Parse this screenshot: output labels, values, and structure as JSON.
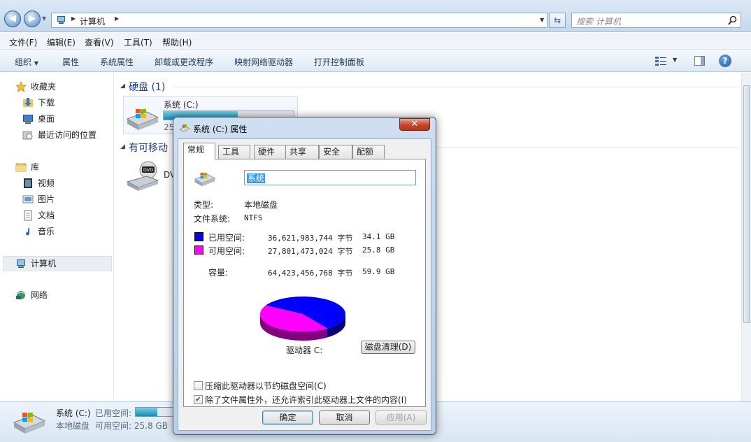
{
  "address_bar": {
    "breadcrumb": "计算机",
    "search_placeholder": "搜索 计算机"
  },
  "menu": [
    "文件(F)",
    "编辑(E)",
    "查看(V)",
    "工具(T)",
    "帮助(H)"
  ],
  "commands": [
    "组织",
    "属性",
    "系统属性",
    "卸载或更改程序",
    "映射网络驱动器",
    "打开控制面板"
  ],
  "sidebar": {
    "favorites": "收藏夹",
    "favorites_items": [
      "下载",
      "桌面",
      "最近访问的位置"
    ],
    "libraries": "库",
    "libraries_items": [
      "视频",
      "图片",
      "文档",
      "音乐"
    ],
    "computer": "计算机",
    "network": "网络"
  },
  "main": {
    "group_hdd": "硬盘 (1)",
    "group_removable": "有可移动",
    "drive_name": "系统 (C:)",
    "drive_free_cut": "25",
    "drive_used_fraction": 0.57,
    "dvd_label_cut": "DV"
  },
  "details": {
    "name": "系统 (C:)",
    "used_label": "已用空间:",
    "type": "本地磁盘",
    "free_text": "可用空间: 25.8 GB",
    "used_fraction": 0.57
  },
  "dialog": {
    "title": "系统 (C:) 属性",
    "close": "✕",
    "tabs": [
      "常规",
      "工具",
      "硬件",
      "共享",
      "安全",
      "配额"
    ],
    "label_value": "系统",
    "type_label": "类型:",
    "type_value": "本地磁盘",
    "fs_label": "文件系统:",
    "fs_value": "NTFS",
    "used_label": "已用空间:",
    "used_bytes": "36,621,983,744 字节",
    "used_gb": "34.1 GB",
    "free_label": "可用空间:",
    "free_bytes": "27,801,473,024 字节",
    "free_gb": "25.8 GB",
    "capacity_label": "容量:",
    "capacity_bytes": "64,423,456,768 字节",
    "capacity_gb": "59.9 GB",
    "drive_caption": "驱动器 C:",
    "cleanup": "磁盘清理(D)",
    "compress": "压缩此驱动器以节约磁盘空间(C)",
    "index": "除了文件属性外，还允许索引此驱动器上文件的内容(I)",
    "index_checked": true,
    "compress_checked": false,
    "ok": "确定",
    "cancel": "取消",
    "apply": "应用(A)",
    "used_color": "#0000ff",
    "free_color": "#ff00ff"
  }
}
